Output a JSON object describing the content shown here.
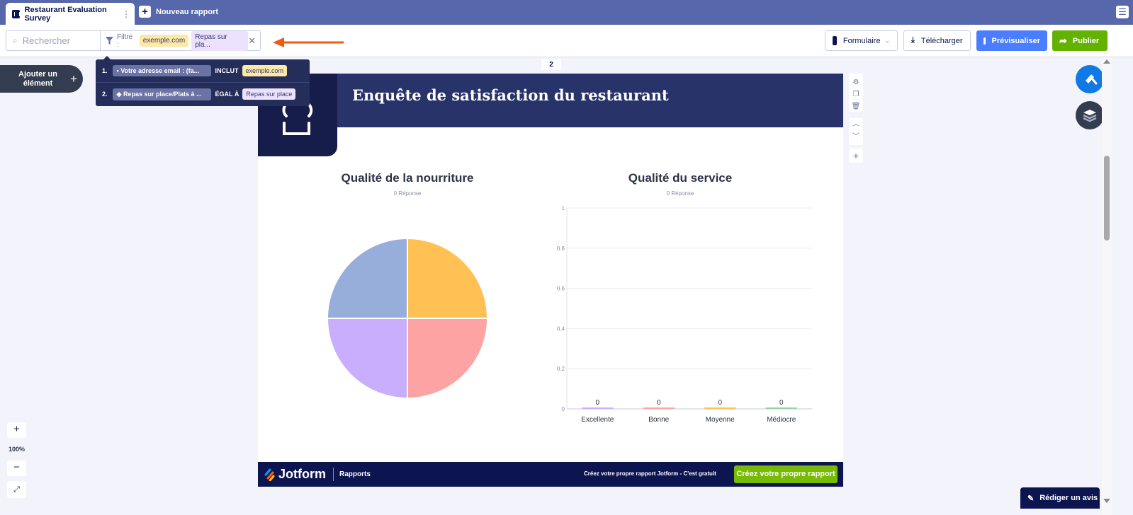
{
  "tabs": {
    "active": "Restaurant Evaluation Survey",
    "new_report": "Nouveau rapport"
  },
  "toolbar": {
    "search_placeholder": "Rechercher",
    "filter_label": "Filtre :",
    "filter_chips": [
      "exemple.com",
      "Repas sur pla..."
    ],
    "form_label": "Formulaire",
    "download_label": "Télécharger",
    "preview_label": "Prévisualiser",
    "publish_label": "Publier"
  },
  "filter_dropdown": [
    {
      "num": "1.",
      "field": "Votre adresse email : (fa...",
      "operator": "INCLUT",
      "value": "exemple.com"
    },
    {
      "num": "2.",
      "field": "Repas sur place/Plats à ...",
      "operator": "ÉGAL À",
      "value": "Repas sur place"
    }
  ],
  "canvas": {
    "page_number": "2",
    "add_element": "Ajouter un élément",
    "zoom_level": "100%"
  },
  "report": {
    "title": "Enquête de satisfaction du restaurant",
    "footer_brand": "Jotform",
    "footer_section": "Rapports",
    "footer_promo": "Créez votre propre rapport Jotform - C'est gratuit",
    "footer_cta": "Créez votre propre rapport"
  },
  "review_button": "Rédiger un avis",
  "colors": {
    "topbar": "#5668ab",
    "navy": "#0c1550",
    "preview": "#4a7dff",
    "publish": "#64b200"
  },
  "chart_data": [
    {
      "type": "pie",
      "title": "Qualité de la nourriture",
      "subtitle": "0 Réponse",
      "values": [
        0,
        0,
        0,
        0
      ],
      "colors": [
        "#ffc154",
        "#fea3a3",
        "#c8aefd",
        "#97aedb"
      ]
    },
    {
      "type": "bar",
      "title": "Qualité du service",
      "subtitle": "0 Réponse",
      "categories": [
        "Excellente",
        "Bonne",
        "Moyenne",
        "Médiocre"
      ],
      "values": [
        0,
        0,
        0,
        0
      ],
      "data_labels": [
        "0",
        "0",
        "0",
        "0"
      ],
      "colors": [
        "#c8aefd",
        "#fea3a3",
        "#ffc154",
        "#8fd5a6"
      ],
      "ylim": [
        0,
        1
      ],
      "yticks": [
        "0",
        "0.2",
        "0.4",
        "0.6",
        "0.8",
        "1"
      ],
      "grid": true
    }
  ]
}
